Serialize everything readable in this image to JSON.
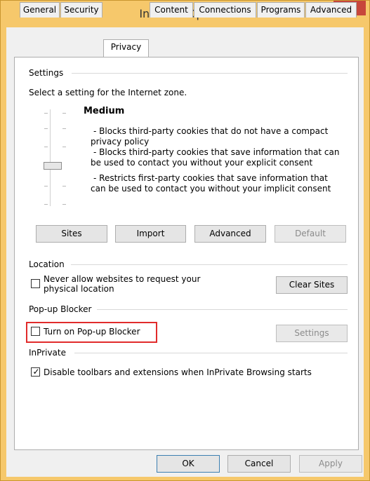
{
  "window": {
    "title": "Internet Options",
    "help_glyph": "?",
    "close_glyph": "✕"
  },
  "tabs": [
    "General",
    "Security",
    "Privacy",
    "Content",
    "Connections",
    "Programs",
    "Advanced"
  ],
  "settings": {
    "group_title": "Settings",
    "intro": "Select a setting for the Internet zone.",
    "level": "Medium",
    "descriptions": [
      "- Blocks third-party cookies that do not have a compact",
      "privacy policy",
      "- Blocks third-party cookies that save information that can",
      "be used to contact you without your explicit consent",
      "- Restricts first-party cookies that save information that",
      "can be used to contact you without your implicit consent"
    ],
    "buttons": {
      "sites": "Sites",
      "import": "Import",
      "advanced": "Advanced",
      "default": "Default"
    }
  },
  "location": {
    "group_title": "Location",
    "checkbox_label_1": "Never allow websites to request your",
    "checkbox_label_2": "physical location",
    "clear_sites": "Clear Sites"
  },
  "popup": {
    "group_title": "Pop-up Blocker",
    "checkbox_label": "Turn on Pop-up Blocker",
    "settings": "Settings"
  },
  "inprivate": {
    "group_title": "InPrivate",
    "checkbox_label": "Disable toolbars and extensions when InPrivate Browsing starts",
    "checked": true
  },
  "footer": {
    "ok": "OK",
    "cancel": "Cancel",
    "apply": "Apply"
  }
}
